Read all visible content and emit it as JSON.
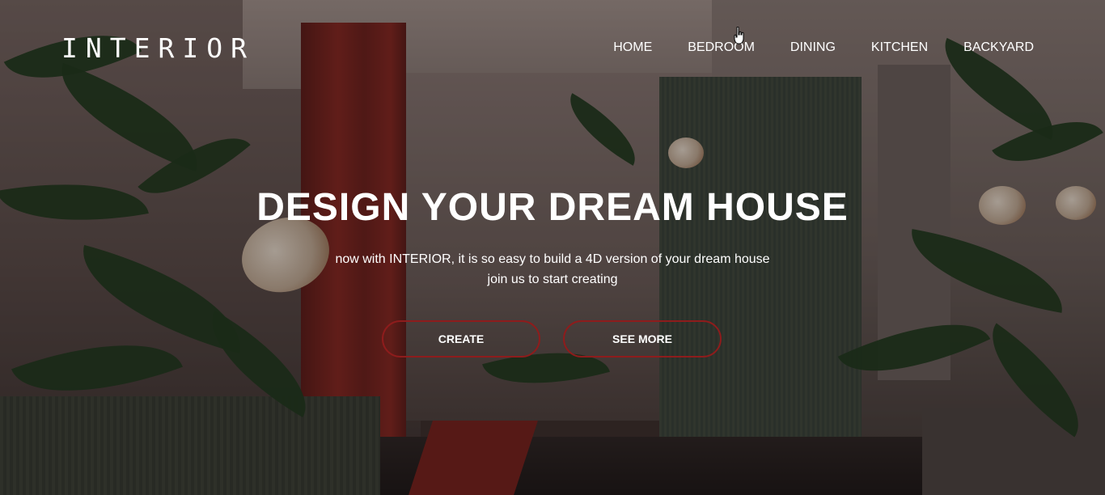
{
  "header": {
    "logo": "INTERIOR",
    "nav": [
      {
        "label": "HOME"
      },
      {
        "label": "BEDROOM"
      },
      {
        "label": "DINING"
      },
      {
        "label": "KITCHEN"
      },
      {
        "label": "BACKYARD"
      }
    ]
  },
  "hero": {
    "title": "DESIGN YOUR DREAM HOUSE",
    "subtitle_line1": "now with INTERIOR, it is so easy to build a 4D version of your dream house",
    "subtitle_line2": "join us to start creating",
    "buttons": {
      "create_label": "CREATE",
      "see_more_label": "SEE MORE"
    }
  },
  "colors": {
    "button_border": "#8e1c1c",
    "text": "#ffffff",
    "accent_red": "#8a2620"
  },
  "icons": {
    "cursor": "hand-pointer-icon"
  }
}
